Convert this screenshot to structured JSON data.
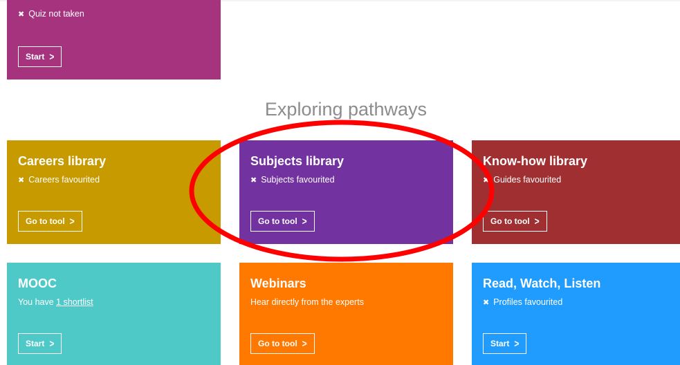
{
  "colors": {
    "quiz": "#a6337e",
    "careers": "#c79a00",
    "subjects": "#7232a0",
    "knowhow": "#a02f32",
    "mooc": "#4fc8c8",
    "webinars": "#ff7800",
    "rwl": "#1f9cfd",
    "annotation": "#ff0000",
    "heading": "#8c8c8c"
  },
  "top_card": {
    "status": "Quiz not taken",
    "button": "Start",
    "status_icon": "x-icon",
    "button_icon": "chevron-right-icon"
  },
  "section": {
    "heading": "Exploring pathways"
  },
  "cards": {
    "careers": {
      "title": "Careers library",
      "status": "Careers favourited",
      "button": "Go to tool"
    },
    "subjects": {
      "title": "Subjects library",
      "status": "Subjects favourited",
      "button": "Go to tool"
    },
    "knowhow": {
      "title": "Know-how library",
      "status": "Guides favourited",
      "button": "Go to tool"
    },
    "mooc": {
      "title": "MOOC",
      "status_prefix": "You have ",
      "status_link": "1 shortlist",
      "button": "Start"
    },
    "webinars": {
      "title": "Webinars",
      "status": "Hear directly from the experts",
      "button": "Go to tool"
    },
    "rwl": {
      "title": "Read, Watch, Listen",
      "status": "Profiles favourited",
      "button": "Start"
    }
  },
  "annotation": {
    "shape": "ellipse-highlight",
    "target": "Subjects library"
  }
}
